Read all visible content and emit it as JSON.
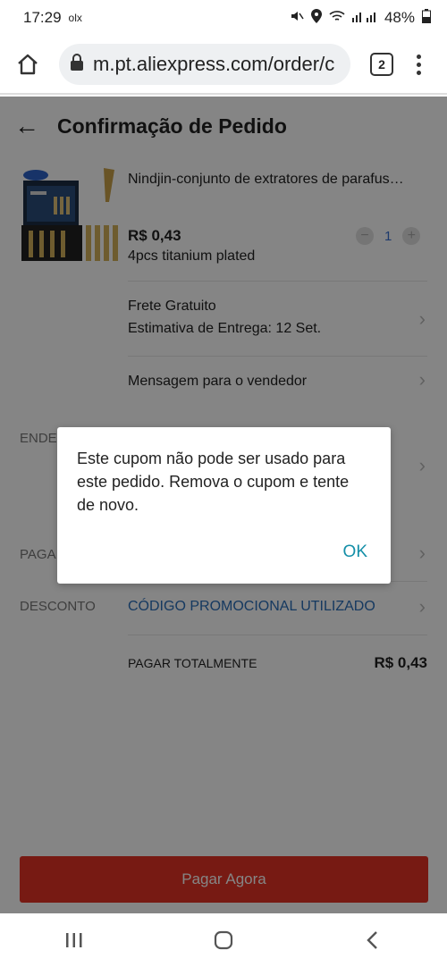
{
  "status_bar": {
    "time": "17:29",
    "app_icons": "olx",
    "battery": "48%"
  },
  "browser": {
    "url": "m.pt.aliexpress.com/order/c",
    "tab_count": "2"
  },
  "page": {
    "title": "Confirmação de Pedido",
    "product": {
      "name": "Nindjin-conjunto de extratores de parafus…",
      "price": "R$ 0,43",
      "variant": "4pcs titanium plated",
      "quantity": "1"
    },
    "shipping": {
      "line1": "Frete Gratuito",
      "line2": "Estimativa de Entrega: 12 Set."
    },
    "seller_message": "Mensagem para o vendedor",
    "address_label": "ENDE",
    "payment_label": "PAGA",
    "discount_label": "DESCONTO",
    "discount_value": "CÓDIGO PROMOCIONAL UTILIZADO",
    "total_label": "PAGAR TOTALMENTE",
    "total_value": "R$ 0,43",
    "pay_button": "Pagar Agora"
  },
  "dialog": {
    "message": "Este cupom não pode ser usado para este pedido. Remova o cupom e tente de novo.",
    "ok_label": "OK"
  },
  "colors": {
    "brand": "#e43225",
    "link": "#148fa8"
  }
}
